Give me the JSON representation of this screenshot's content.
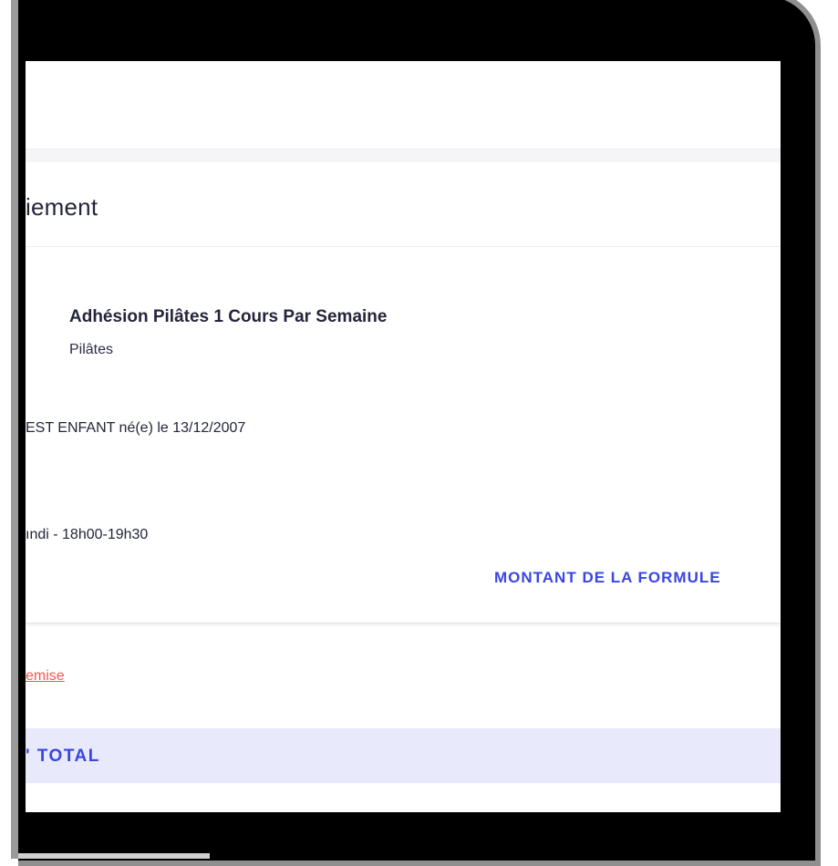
{
  "card": {
    "title": "iement"
  },
  "item": {
    "name": "Adhésion Pilâtes 1 Cours Par Semaine",
    "category": "Pilâtes"
  },
  "participant": {
    "text": "EST ENFANT né(e) le 13/12/2007"
  },
  "schedule": {
    "text": "ındi - 18h00-19h30"
  },
  "amount": {
    "label": "MONTANT DE LA FORMULE"
  },
  "discount": {
    "link": "emise"
  },
  "total": {
    "label": "' TOTAL"
  },
  "colors": {
    "accent": "#3a46e0",
    "discount": "#ee5a4f",
    "total_bar": "#e8e9fb",
    "text": "#23263b"
  }
}
